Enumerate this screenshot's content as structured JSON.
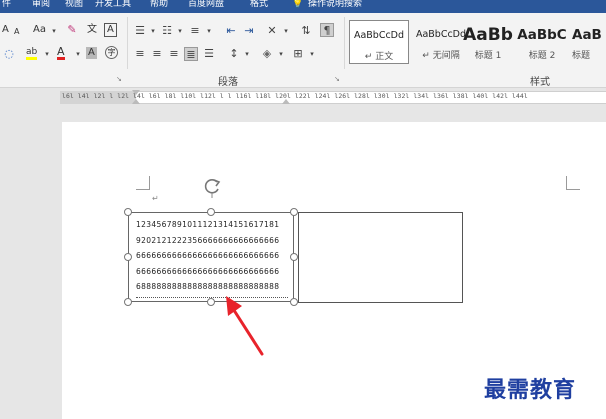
{
  "menu": {
    "items": [
      "件",
      "审阅",
      "视图",
      "开发工具",
      "帮助",
      "百度网盘",
      "格式",
      "操作说明搜索"
    ]
  },
  "ribbon": {
    "font_size_grow": "A",
    "font_size_shrink": "A",
    "change_case": "Aa",
    "clear_format_icon": "eraser",
    "phonetic_guide": "文",
    "char_border": "A",
    "highlight": "ab",
    "font_color": "A",
    "char_shading": "A",
    "enclose_char": "字",
    "group_paragraph": "段落",
    "group_styles": "样式",
    "styles": [
      {
        "sample": "AaBbCcDd",
        "name": "↵ 正文"
      },
      {
        "sample": "AaBbCcDd",
        "name": "↵ 无间隔"
      },
      {
        "sample": "AaBb",
        "name": "标题 1"
      },
      {
        "sample": "AaBbC",
        "name": "标题 2"
      },
      {
        "sample": "AaB",
        "name": "标题"
      }
    ]
  },
  "ruler": {
    "numbers": "l6l l4l l2l l l2l l4l l6l l8l l10l l12l l l l16l l18l l20l l22l l24l l26l l28l l30l l32l l34l l36l l38l l40l l42l l44l"
  },
  "document": {
    "paragraph_mark": "↵",
    "textbox_lines": [
      "1234567891011121314151617181",
      "9202121222356666666666666666",
      "6666666666666666666666666666",
      "6666666666666666666666666666",
      "6888888888888888888888888888"
    ]
  },
  "colors": {
    "accent": "#2b579a",
    "highlight_yellow": "#ffff00",
    "font_red": "#e02020",
    "arrow_red": "#e8232b",
    "watermark_blue": "#1f3fa0"
  },
  "watermark": "最需教育"
}
